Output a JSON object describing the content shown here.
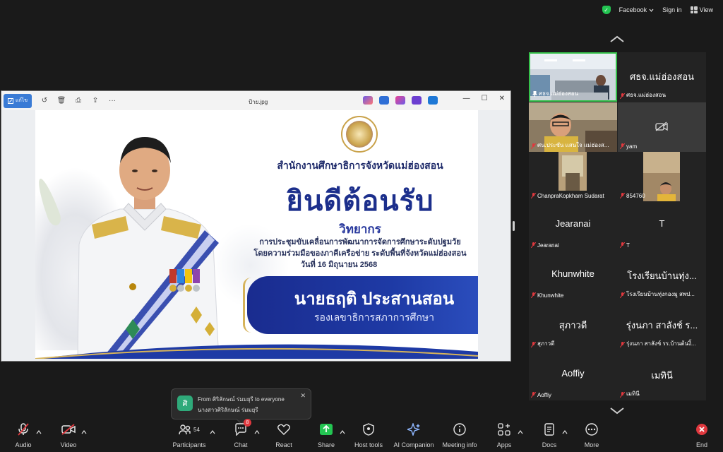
{
  "topbar": {
    "account": "Facebook",
    "signin": "Sign in",
    "view": "View"
  },
  "share": {
    "edit_label": "แก้ไข",
    "filename": "ป้าย.jpg",
    "poster": {
      "office": "สำนักงานศึกษาธิการจังหวัดแม่ฮ่องสอน",
      "welcome": "ยินดีต้อนรับ",
      "speaker_label": "วิทยากร",
      "line1": "การประชุมขับเคลื่อนการพัฒนาการจัดการศึกษาระดับปฐมวัย",
      "line2": "โดยความร่วมมือของภาคีเครือข่าย ระดับพื้นที่จังหวัดแม่ฮ่องสอน",
      "line3": "วันที่ 16 มิถุนายน 2568",
      "name": "นายธฤติ ประสานสอน",
      "title": "รองเลขาธิการสภาการศึกษา"
    }
  },
  "gallery": {
    "tiles": [
      {
        "big": "",
        "small": "ศธจ.แม่ฮ่องสอน",
        "video": true
      },
      {
        "big": "ศธจ.แม่ฮ่องสอน",
        "small": "ศธจ.แม่ฮ่องสอน",
        "video": false
      },
      {
        "big": "",
        "small": "ศน.ประชัน แสนใจ แม่ฮ่องส...",
        "video": true
      },
      {
        "big": "",
        "small": "yam",
        "video": false
      },
      {
        "big": "",
        "small": "ChanpraKopkham Sudarat",
        "video": true
      },
      {
        "big": "",
        "small": "854760",
        "video": true
      },
      {
        "big": "Jearanai",
        "small": "Jearanai",
        "video": false
      },
      {
        "big": "T",
        "small": "T",
        "video": false
      },
      {
        "big": "Khunwhite",
        "small": "Khunwhite",
        "video": false
      },
      {
        "big": "โรงเรียนบ้านทุ่ง...",
        "small": "โรงเรียนบ้านทุ่งกองมู สพป...",
        "video": false
      },
      {
        "big": "สุภาวดี",
        "small": "สุภาวดี",
        "video": false
      },
      {
        "big": "รุ่งนภา สาลังช์ ร...",
        "small": "รุ่งนภา สาลังช์ รร.บ้านต้นงิ้...",
        "video": false
      },
      {
        "big": "Aoffiy",
        "small": "Aoffiy",
        "video": false
      },
      {
        "big": "เมทินี",
        "small": "เมทินี",
        "video": false
      }
    ]
  },
  "toast": {
    "avatar": "ศิ",
    "from": "From ศิริลักษณ์ ร่มมยุรี to everyone",
    "message": "นางสาวศิริลักษณ์ ร่มมยุรี"
  },
  "toolbar": {
    "audio": "Audio",
    "video": "Video",
    "participants": "Participants",
    "participants_count": "54",
    "chat": "Chat",
    "chat_badge": "8",
    "react": "React",
    "share": "Share",
    "host_tools": "Host tools",
    "ai_companion": "AI Companion",
    "meeting_info": "Meeting info",
    "apps": "Apps",
    "docs": "Docs",
    "more": "More",
    "end": "End"
  },
  "colors": {
    "accent_green": "#23c552",
    "end_red": "#e0383e",
    "poster_blue": "#1c2f8c"
  }
}
